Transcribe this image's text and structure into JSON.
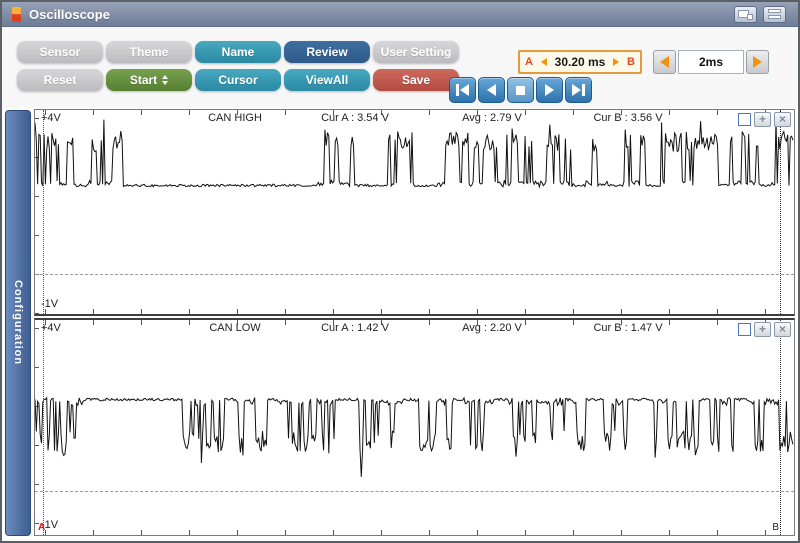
{
  "window": {
    "title": "Oscilloscope",
    "titlebar_icons": [
      {
        "name": "new-window"
      },
      {
        "name": "tile-windows"
      }
    ]
  },
  "toolbar": {
    "buttons_row1": [
      {
        "label": "Sensor"
      },
      {
        "label": "Theme"
      },
      {
        "label": "Name"
      },
      {
        "label": "Review"
      },
      {
        "label": "User Setting"
      }
    ],
    "buttons_row2": [
      {
        "label": "Reset"
      },
      {
        "label": "Start"
      },
      {
        "label": "Cursor"
      },
      {
        "label": "ViewAll"
      },
      {
        "label": "Save"
      }
    ],
    "ab_readout": {
      "a": "A",
      "b": "B",
      "value": "30.20 ms"
    },
    "timebase": {
      "value": "2ms"
    }
  },
  "sidebar": {
    "tab": "Configuration"
  },
  "channel_controls": {
    "zoom_glyph": "+",
    "close_glyph": "×"
  },
  "cursors": {
    "a": "A",
    "b": "B"
  },
  "channels": [
    {
      "name": "CAN HIGH",
      "top_label": "+4V",
      "bottom_label": "-1V",
      "cur_a": "Cur A : 3.54 V",
      "avg": "Avg : 2.79 V",
      "cur_b": "Cur B : 3.56 V",
      "waveform": {
        "direction": "up",
        "seed": 7,
        "baseline_frac": 0.37,
        "active_frac": 0.155,
        "noise_frac": 0.05,
        "bursts": [
          [
            0,
            0.05
          ],
          [
            0.07,
            0.115
          ],
          [
            0.37,
            0.42
          ],
          [
            0.465,
            0.5
          ],
          [
            0.53,
            0.71
          ],
          [
            0.725,
            0.755
          ],
          [
            0.775,
            0.805
          ],
          [
            0.825,
            0.9
          ],
          [
            0.915,
            0.955
          ],
          [
            0.97,
            1.0
          ]
        ],
        "deep_spikes": []
      }
    },
    {
      "name": "CAN LOW",
      "top_label": "+4V",
      "bottom_label": "-1V",
      "cur_a": "Cur A : 1.42 V",
      "avg": "Avg : 2.20 V",
      "cur_b": "Cur B : 1.47 V",
      "waveform": {
        "direction": "down",
        "seed": 13,
        "baseline_frac": 0.37,
        "active_frac": 0.565,
        "noise_frac": 0.05,
        "bursts": [
          [
            0,
            0.065
          ],
          [
            0.195,
            0.25
          ],
          [
            0.265,
            0.305
          ],
          [
            0.32,
            0.395
          ],
          [
            0.425,
            0.485
          ],
          [
            0.5,
            0.55
          ],
          [
            0.565,
            0.605
          ],
          [
            0.625,
            0.725
          ],
          [
            0.75,
            0.78
          ],
          [
            0.815,
            0.875
          ],
          [
            0.89,
            0.92
          ],
          [
            0.94,
            1.0
          ]
        ],
        "deep_spikes": [
          0.43
        ]
      }
    }
  ],
  "colors": {
    "teal": "#2f93ab",
    "review_blue": "#33669c",
    "start_green": "#5a8a3c",
    "save_red": "#c05048",
    "playback_blue": "#2f7fc1",
    "accent_orange": "#f0940f",
    "cursor_a_red": "#e31515",
    "titlebar_gray_blue": "#77839c",
    "config_tab_blue": "#4a6da0"
  }
}
